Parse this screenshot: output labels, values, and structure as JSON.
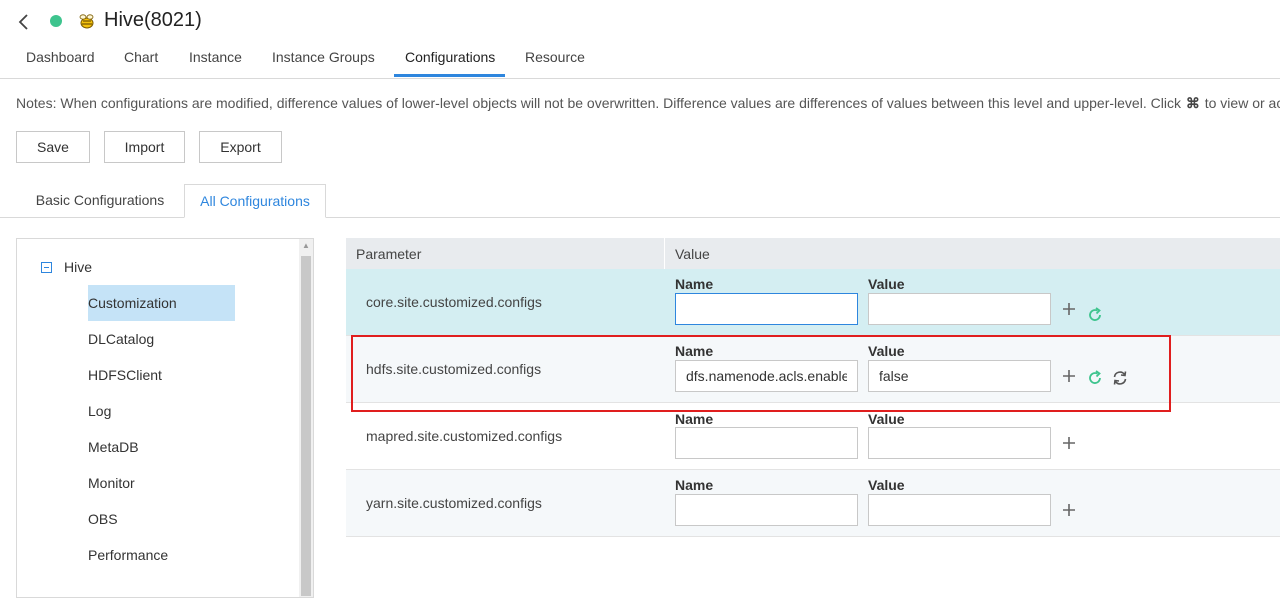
{
  "header": {
    "title": "Hive(8021)",
    "status_color": "#3ec48e",
    "back_icon": "chevron-left-icon",
    "logo_icon": "hive-bee-icon"
  },
  "nav": {
    "tabs": [
      {
        "label": "Dashboard"
      },
      {
        "label": "Chart"
      },
      {
        "label": "Instance"
      },
      {
        "label": "Instance Groups"
      },
      {
        "label": "Configurations",
        "active": true
      },
      {
        "label": "Resource"
      }
    ]
  },
  "notes": {
    "text_before": "Notes: When configurations are modified, difference values of lower-level objects will not be overwritten. Difference values are differences of values between this level and upper-level. Click ",
    "icon": "diff-view-icon",
    "text_after": " to view or ac"
  },
  "toolbar": {
    "save_label": "Save",
    "import_label": "Import",
    "export_label": "Export"
  },
  "subtabs": {
    "basic_label": "Basic Configurations",
    "all_label": "All Configurations"
  },
  "tree": {
    "root": "Hive",
    "items": [
      {
        "label": "Customization",
        "selected": true
      },
      {
        "label": "DLCatalog"
      },
      {
        "label": "HDFSClient"
      },
      {
        "label": "Log"
      },
      {
        "label": "MetaDB"
      },
      {
        "label": "Monitor"
      },
      {
        "label": "OBS"
      },
      {
        "label": "Performance"
      }
    ]
  },
  "table": {
    "col_parameter": "Parameter",
    "col_value": "Value",
    "name_label": "Name",
    "value_label": "Value",
    "rows": [
      {
        "parameter": "core.site.customized.configs",
        "name": "",
        "value": ""
      },
      {
        "parameter": "hdfs.site.customized.configs",
        "name": "dfs.namenode.acls.enabled",
        "value": "false"
      },
      {
        "parameter": "mapred.site.customized.configs",
        "name": "",
        "value": ""
      },
      {
        "parameter": "yarn.site.customized.configs",
        "name": "",
        "value": ""
      }
    ]
  },
  "colors": {
    "accent": "#2e86de",
    "highlight_row": "#d4eef2",
    "callout_border": "#e01e1e",
    "refresh_green": "#3ec48e"
  }
}
